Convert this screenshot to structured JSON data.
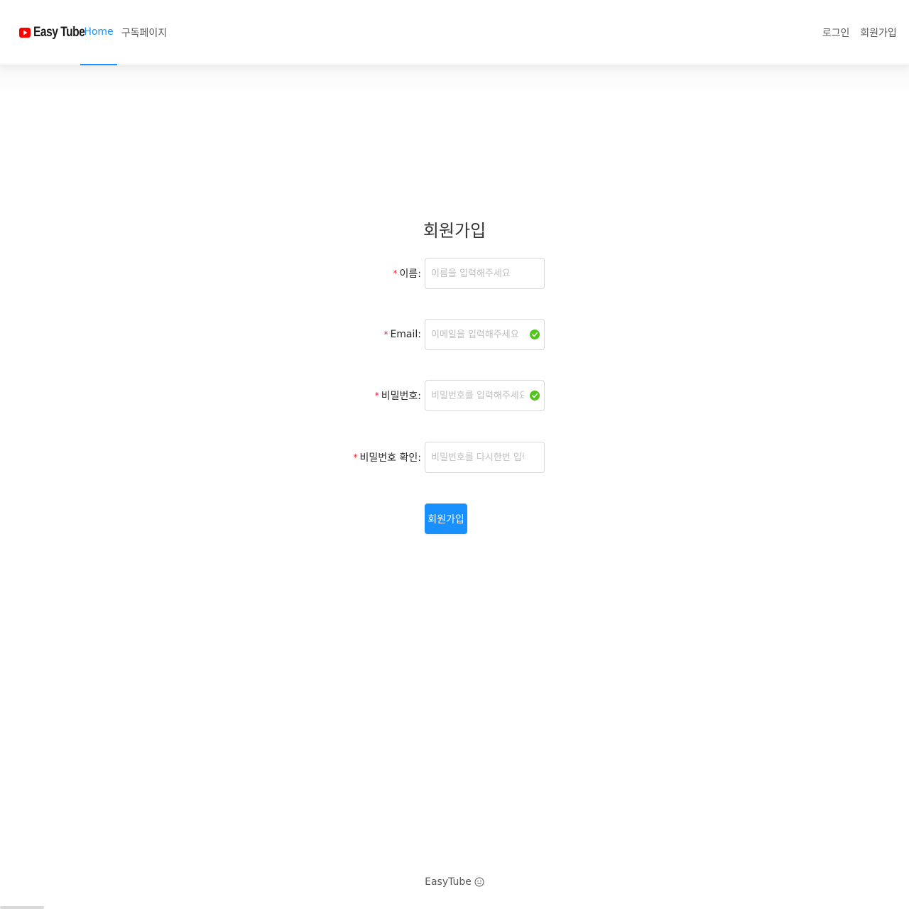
{
  "header": {
    "logo_text": "Easy Tube",
    "nav_left": [
      {
        "label": "Home",
        "active": true
      },
      {
        "label": "구독페이지",
        "active": false
      }
    ],
    "nav_right": [
      {
        "label": "로그인"
      },
      {
        "label": "회원가입"
      }
    ]
  },
  "form": {
    "title": "회원가입",
    "fields": [
      {
        "label": "이름:",
        "placeholder": "이름을 입력해주세요",
        "value": "",
        "validated": false
      },
      {
        "label": "Email:",
        "placeholder": "이메일을 입력해주세요",
        "value": "",
        "validated": true
      },
      {
        "label": "비밀번호:",
        "placeholder": "비밀번호를 입력해주세요",
        "value": "",
        "validated": true
      },
      {
        "label": "비밀번호 확인:",
        "placeholder": "비밀번호를 다시한번 입력해주세요",
        "value": "",
        "validated": false
      }
    ],
    "submit_label": "회원가입"
  },
  "footer": {
    "text": "EasyTube"
  },
  "colors": {
    "primary": "#1890ff",
    "success": "#52c41a",
    "required": "#f5222d",
    "logo_red": "#ff0000"
  },
  "icons": {
    "logo": "youtube-play-icon",
    "success": "check-circle-icon",
    "footer": "smile-icon"
  }
}
